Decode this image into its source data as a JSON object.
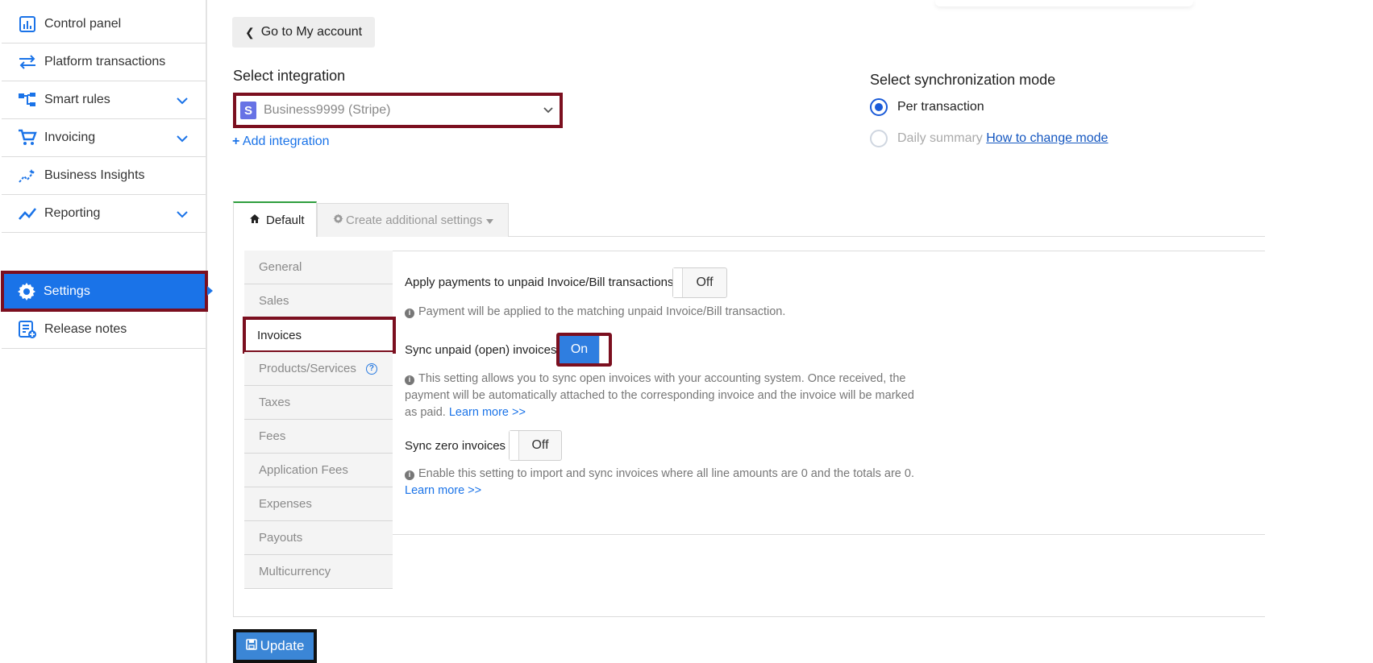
{
  "sidebar": {
    "items": [
      {
        "label": "Control panel",
        "icon": "chart-box-icon"
      },
      {
        "label": "Platform transactions",
        "icon": "transfer-arrows-icon"
      },
      {
        "label": "Smart rules",
        "icon": "hierarchy-icon"
      },
      {
        "label": "Invoicing",
        "icon": "cart-icon"
      },
      {
        "label": "Business Insights",
        "icon": "sparkle-chart-icon"
      },
      {
        "label": "Reporting",
        "icon": "trend-line-icon"
      },
      {
        "label": "Settings",
        "icon": "gear-icon"
      },
      {
        "label": "Release notes",
        "icon": "notes-icon"
      }
    ]
  },
  "header": {
    "back_label": "Go to My account"
  },
  "integration": {
    "label": "Select integration",
    "selected": "Business9999 (Stripe)",
    "logo_letter": "S",
    "add_label": "Add integration"
  },
  "sync_mode": {
    "label": "Select synchronization mode",
    "option_per_transaction": "Per transaction",
    "option_daily": "Daily summary",
    "how_to_link": "How to change mode"
  },
  "tabs": {
    "default": "Default",
    "additional": "Create additional settings"
  },
  "subnav": {
    "items": [
      "General",
      "Sales",
      "Invoices",
      "Products/Services",
      "Taxes",
      "Fees",
      "Application Fees",
      "Expenses",
      "Payouts",
      "Multicurrency"
    ]
  },
  "settings": {
    "apply_payments": {
      "label": "Apply payments to unpaid Invoice/Bill transactions",
      "state": "Off",
      "help": "Payment will be applied to the matching unpaid Invoice/Bill transaction."
    },
    "sync_unpaid": {
      "label": "Sync unpaid (open) invoices",
      "state": "On",
      "help_line1": "This setting allows you to sync open invoices with your accounting system. Once received, the",
      "help_line2": "payment will be automatically attached to the corresponding invoice and the invoice will be marked",
      "help_line3": "as paid.",
      "learn_more": "Learn more >>"
    },
    "sync_zero": {
      "label": "Sync zero invoices",
      "state": "Off",
      "help": "Enable this setting to import and sync invoices where all line amounts are 0 and the totals are 0.",
      "learn_more": "Learn more >>"
    }
  },
  "footer": {
    "update_label": "Update"
  },
  "colors": {
    "accent": "#1a73e8",
    "highlight_border": "#7b0f1f",
    "tab_active": "#2e9e3e",
    "stripe": "#6772e5"
  }
}
